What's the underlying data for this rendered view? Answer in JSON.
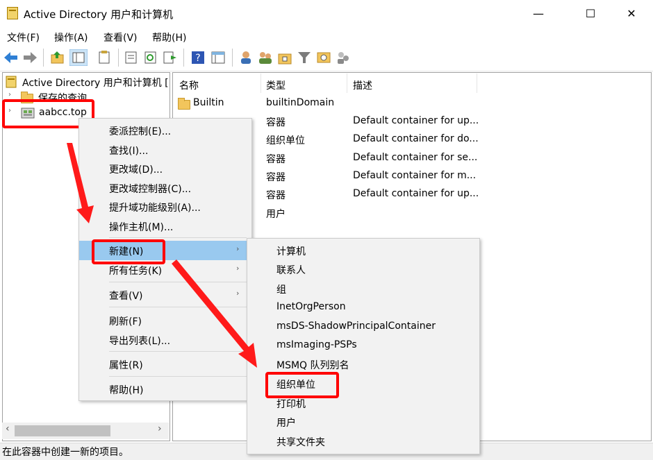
{
  "window": {
    "title": "Active Directory 用户和计算机",
    "minimize": "—",
    "maximize": "☐",
    "close": "✕"
  },
  "menubar": {
    "items": [
      "文件(F)",
      "操作(A)",
      "查看(V)",
      "帮助(H)"
    ]
  },
  "toolbar": {
    "icons": [
      "back-icon",
      "forward-icon",
      "up-folder-icon",
      "show-tree-icon",
      "copy-icon",
      "properties-icon",
      "refresh-icon",
      "export-icon",
      "help-icon",
      "details-icon",
      "new-user-icon",
      "new-group-icon",
      "new-ou-icon",
      "filter-icon",
      "find-icon",
      "add-to-group-icon"
    ]
  },
  "tree": {
    "root": "Active Directory 用户和计算机 [",
    "saved_queries": "保存的查询",
    "domain": "aabcc.top"
  },
  "list": {
    "columns": [
      "名称",
      "类型",
      "描述"
    ],
    "rows": [
      {
        "name": "Builtin",
        "type": "builtinDomain",
        "desc": ""
      },
      {
        "name": "",
        "type": "容器",
        "desc": "Default container for up..."
      },
      {
        "name": "",
        "type": "组织单位",
        "desc": "Default container for do..."
      },
      {
        "name": "",
        "type": "容器",
        "desc": "Default container for se..."
      },
      {
        "name": "",
        "type": "容器",
        "desc": "Default container for m..."
      },
      {
        "name": "",
        "type": "容器",
        "desc": "Default container for up..."
      },
      {
        "name": "",
        "type": "用户",
        "desc": ""
      }
    ]
  },
  "context_menu": {
    "items": [
      "委派控制(E)...",
      "查找(I)...",
      "更改域(D)...",
      "更改域控制器(C)...",
      "提升域功能级别(A)...",
      "操作主机(M)...",
      "新建(N)",
      "所有任务(K)",
      "查看(V)",
      "刷新(F)",
      "导出列表(L)...",
      "属性(R)",
      "帮助(H)"
    ],
    "submenu_arrow": "›"
  },
  "submenu_new": {
    "items": [
      "计算机",
      "联系人",
      "组",
      "InetOrgPerson",
      "msDS-ShadowPrincipalContainer",
      "msImaging-PSPs",
      "MSMQ 队列别名",
      "组织单位",
      "打印机",
      "用户",
      "共享文件夹"
    ]
  },
  "scrollbar": {
    "left_arrow": "‹",
    "right_arrow": "›",
    "thumb_fraction": 0.6
  },
  "status": {
    "text": "在此容器中创建一新的项目。"
  },
  "colors": {
    "highlight": "#99c9ef",
    "annotation": "#ff0000",
    "menu_bg": "#f2f2f2"
  }
}
